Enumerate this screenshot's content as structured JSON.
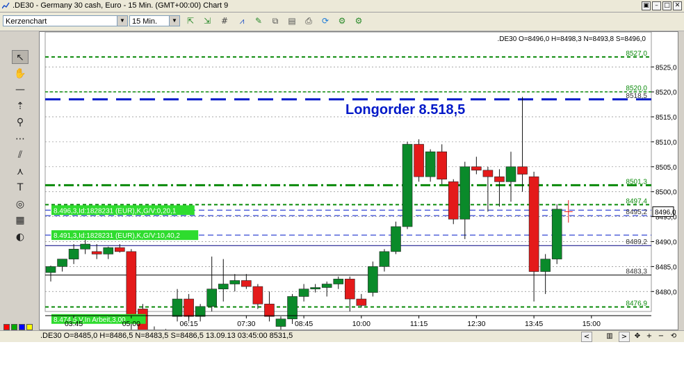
{
  "window": {
    "title": ".DE30 - Germany 30 cash, Euro - 15 Min. (GMT+00:00)   Chart 9",
    "buttons": [
      "▣",
      "–",
      "□",
      "✕"
    ]
  },
  "toolbar": {
    "chart_type": "Kerzenchart",
    "timeframe": "15 Min.",
    "icons": [
      "zoom-in-icon",
      "zoom-out-icon",
      "grid-icon",
      "indicator-icon",
      "edit-icon",
      "compare-icon",
      "template-icon",
      "print-icon",
      "refresh-icon",
      "settings-icon",
      "settings2-icon"
    ]
  },
  "tools": [
    {
      "name": "pointer-tool-icon",
      "glyph": "↖"
    },
    {
      "name": "hand-tool-icon",
      "glyph": "✋"
    },
    {
      "name": "line-tool-icon",
      "glyph": "—"
    },
    {
      "name": "arrow-tool-icon",
      "glyph": "⇡"
    },
    {
      "name": "zoom-tool-icon",
      "glyph": "⚲"
    },
    {
      "name": "fibonacci-tool-icon",
      "glyph": "⋯"
    },
    {
      "name": "fan-tool-icon",
      "glyph": "⫽"
    },
    {
      "name": "pitchfork-tool-icon",
      "glyph": "⋏"
    },
    {
      "name": "text-tool-icon",
      "glyph": "T"
    },
    {
      "name": "cycle-tool-icon",
      "glyph": "◎"
    },
    {
      "name": "calculator-tool-icon",
      "glyph": "▦"
    },
    {
      "name": "alert-tool-icon",
      "glyph": "◐"
    }
  ],
  "colors": [
    "#ff0000",
    "#00aa00",
    "#0000ff",
    "#ffff00",
    "#ffffff",
    "#000000",
    "#8b0000",
    "#606060"
  ],
  "chart_data": {
    "type": "candlestick",
    "info_text": ".DE30 O=8496,0 H=8498,3 N=8493,8 S=8496,0",
    "ylim": [
      8476,
      8532
    ],
    "x_ticks": [
      "03:45",
      "05:00",
      "06:15",
      "07:30",
      "08:45",
      "10:00",
      "11:15",
      "12:30",
      "13:45",
      "15:00"
    ],
    "y_ticks": [
      "8525,0",
      "8520,0",
      "8515,0",
      "8510,0",
      "8505,0",
      "8500,0",
      "8495,0",
      "8490,0",
      "8485,0",
      "8480,0"
    ],
    "candles": [
      {
        "o": 8483.8,
        "h": 8485.2,
        "l": 8482.0,
        "c": 8485.0
      },
      {
        "o": 8485.0,
        "h": 8486.5,
        "l": 8484.0,
        "c": 8486.5
      },
      {
        "o": 8486.5,
        "h": 8489.5,
        "l": 8485.5,
        "c": 8488.5
      },
      {
        "o": 8488.5,
        "h": 8490.5,
        "l": 8487.5,
        "c": 8489.5
      },
      {
        "o": 8488.0,
        "h": 8489.5,
        "l": 8486.5,
        "c": 8487.5
      },
      {
        "o": 8487.5,
        "h": 8489.0,
        "l": 8486.5,
        "c": 8488.8
      },
      {
        "o": 8488.8,
        "h": 8489.5,
        "l": 8487.8,
        "c": 8488.0
      },
      {
        "o": 8488.0,
        "h": 8488.5,
        "l": 8472.0,
        "c": 8474.0
      },
      {
        "o": 8476.5,
        "h": 8477.5,
        "l": 8470.5,
        "c": 8472.0
      },
      {
        "o": 8472.0,
        "h": 8473.0,
        "l": 8470.0,
        "c": 8471.0
      },
      {
        "o": 8471.0,
        "h": 8472.5,
        "l": 8469.5,
        "c": 8472.0
      },
      {
        "o": 8475.0,
        "h": 8480.5,
        "l": 8474.0,
        "c": 8478.5
      },
      {
        "o": 8478.5,
        "h": 8479.5,
        "l": 8474.0,
        "c": 8475.0
      },
      {
        "o": 8475.0,
        "h": 8477.5,
        "l": 8474.0,
        "c": 8477.0
      },
      {
        "o": 8477.0,
        "h": 8487.0,
        "l": 8476.0,
        "c": 8480.5
      },
      {
        "o": 8480.5,
        "h": 8486.5,
        "l": 8478.0,
        "c": 8481.5
      },
      {
        "o": 8481.5,
        "h": 8483.5,
        "l": 8480.0,
        "c": 8482.2
      },
      {
        "o": 8482.2,
        "h": 8483.5,
        "l": 8480.5,
        "c": 8481.0
      },
      {
        "o": 8481.0,
        "h": 8481.5,
        "l": 8476.5,
        "c": 8477.5
      },
      {
        "o": 8477.5,
        "h": 8480.0,
        "l": 8474.0,
        "c": 8475.0
      },
      {
        "o": 8473.0,
        "h": 8475.0,
        "l": 8472.0,
        "c": 8474.5
      },
      {
        "o": 8474.5,
        "h": 8479.5,
        "l": 8473.5,
        "c": 8479.0
      },
      {
        "o": 8479.0,
        "h": 8481.5,
        "l": 8478.0,
        "c": 8480.5
      },
      {
        "o": 8480.5,
        "h": 8481.5,
        "l": 8479.8,
        "c": 8480.8
      },
      {
        "o": 8480.8,
        "h": 8482.0,
        "l": 8479.0,
        "c": 8481.5
      },
      {
        "o": 8481.5,
        "h": 8483.0,
        "l": 8480.5,
        "c": 8482.5
      },
      {
        "o": 8482.5,
        "h": 8483.0,
        "l": 8476.0,
        "c": 8478.5
      },
      {
        "o": 8478.5,
        "h": 8479.5,
        "l": 8476.8,
        "c": 8477.2
      },
      {
        "o": 8479.8,
        "h": 8486.0,
        "l": 8479.0,
        "c": 8485.0
      },
      {
        "o": 8485.0,
        "h": 8488.5,
        "l": 8484.0,
        "c": 8488.0
      },
      {
        "o": 8488.0,
        "h": 8494.0,
        "l": 8487.5,
        "c": 8493.0
      },
      {
        "o": 8493.0,
        "h": 8510.0,
        "l": 8492.5,
        "c": 8509.5
      },
      {
        "o": 8509.5,
        "h": 8510.5,
        "l": 8502.0,
        "c": 8503.0
      },
      {
        "o": 8503.0,
        "h": 8508.5,
        "l": 8502.0,
        "c": 8508.0
      },
      {
        "o": 8508.0,
        "h": 8509.5,
        "l": 8501.5,
        "c": 8502.5
      },
      {
        "o": 8502.0,
        "h": 8502.5,
        "l": 8493.5,
        "c": 8494.5
      },
      {
        "o": 8494.5,
        "h": 8506.0,
        "l": 8490.5,
        "c": 8505.0
      },
      {
        "o": 8505.0,
        "h": 8507.0,
        "l": 8503.5,
        "c": 8504.3
      },
      {
        "o": 8504.3,
        "h": 8505.0,
        "l": 8496.0,
        "c": 8503.0
      },
      {
        "o": 8503.0,
        "h": 8504.5,
        "l": 8497.0,
        "c": 8502.0
      },
      {
        "o": 8502.0,
        "h": 8508.0,
        "l": 8498.0,
        "c": 8505.0
      },
      {
        "o": 8505.0,
        "h": 8519.0,
        "l": 8500.0,
        "c": 8503.5
      },
      {
        "o": 8503.0,
        "h": 8504.0,
        "l": 8478.0,
        "c": 8484.0
      },
      {
        "o": 8484.0,
        "h": 8487.5,
        "l": 8479.5,
        "c": 8486.5
      },
      {
        "o": 8486.5,
        "h": 8497.5,
        "l": 8485.5,
        "c": 8496.5
      },
      {
        "o": 8496.0,
        "h": 8498.3,
        "l": 8493.8,
        "c": 8496.0
      }
    ],
    "levels": [
      {
        "value": 8527.0,
        "label": "8527,0",
        "color": "#0a8a0a",
        "style": "dot-dash-thick",
        "labelColor": "#0a8a0a"
      },
      {
        "value": 8520.0,
        "label": "8520,0",
        "color": "#0a8a0a",
        "style": "dash",
        "labelColor": "#0a8a0a"
      },
      {
        "value": 8518.5,
        "label": "8518,5",
        "color": "#0018c8",
        "style": "longdash",
        "labelColor": "#333333"
      },
      {
        "value": 8501.3,
        "label": "8501,3",
        "color": "#0a8a0a",
        "style": "dashdot",
        "labelColor": "#0a8a0a"
      },
      {
        "value": 8497.4,
        "label": "8497,4",
        "color": "#0a8a0a",
        "style": "dot-dash-thick",
        "labelColor": "#0a8a0a"
      },
      {
        "value": 8496.3,
        "label": "",
        "color": "#0018c8",
        "style": "dash-thin",
        "labelColor": "#0018c8"
      },
      {
        "value": 8495.2,
        "label": "8495,2",
        "color": "#0018c8",
        "style": "dash-thin",
        "labelColor": "#333333"
      },
      {
        "value": 8491.3,
        "label": "",
        "color": "#0018c8",
        "style": "dash-thin",
        "labelColor": "#0018c8"
      },
      {
        "value": 8489.2,
        "label": "8489,2",
        "color": "#000080",
        "style": "solid",
        "labelColor": "#333333"
      },
      {
        "value": 8483.3,
        "label": "8483,3",
        "color": "#000000",
        "style": "solid",
        "labelColor": "#333333"
      },
      {
        "value": 8476.9,
        "label": "8476,9",
        "color": "#0a8a0a",
        "style": "dot-dash-thick",
        "labelColor": "#0a8a0a"
      }
    ],
    "gridlines": [
      8525,
      8520,
      8515,
      8510,
      8505,
      8500,
      8495,
      8490,
      8485,
      8480
    ],
    "order_labels": [
      {
        "text": "8.496,3,Id:1828231 (EUR),K,G/V:0,20,1",
        "value": 8496.3
      },
      {
        "text": "8.491,3,Id:1828231 (EUR),K,G/V:10,40,2",
        "value": 8491.3
      },
      {
        "text": "8.474,5,V,In Arbeit,3,00",
        "value": 8474.5
      }
    ],
    "annotation": "Longorder 8.518,5",
    "current_price": "8496,0"
  },
  "status": {
    "text": ".DE30 O=8485,0 H=8486,5 N=8483,5 S=8486,5   13.09.13 03:45:00 8531,5",
    "buttons": [
      "<",
      "▥",
      ">",
      "✥",
      "+",
      "−",
      "⟲"
    ]
  }
}
